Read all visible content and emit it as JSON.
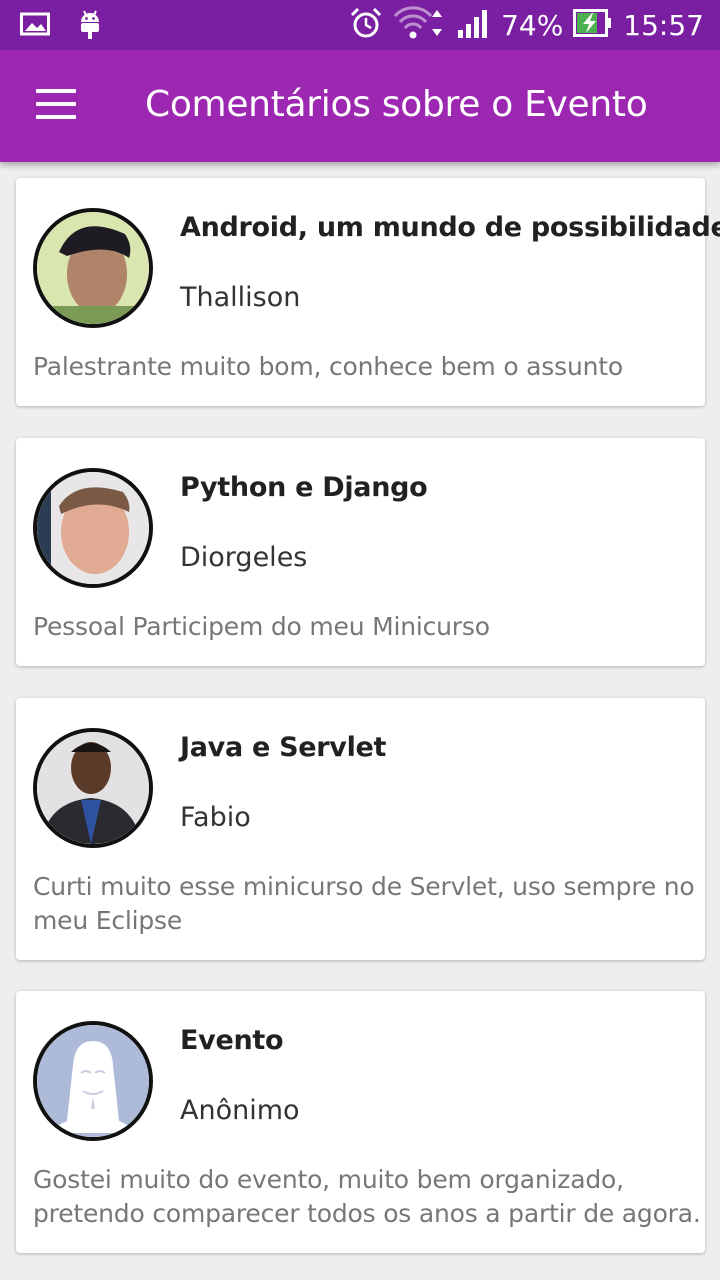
{
  "status_bar": {
    "battery": "74%",
    "time": "15:57",
    "icons": [
      "image-icon",
      "android-icon",
      "alarm-icon",
      "wifi-icon",
      "signal-icon",
      "battery-charging-icon"
    ]
  },
  "app_bar": {
    "menu_icon": "menu-icon",
    "title": "Comentários sobre o Evento"
  },
  "colors": {
    "status_bar": "#7B1FA2",
    "app_bar": "#9C27B0",
    "background": "#eeeeee"
  },
  "comments": [
    {
      "title": "Android, um mundo de possibilidades",
      "author": "Thallison",
      "text": "Palestrante muito bom, conhece bem o assunto"
    },
    {
      "title": "Python e Django",
      "author": "Diorgeles",
      "text": "Pessoal Participem do meu Minicurso"
    },
    {
      "title": "Java e Servlet",
      "author": "Fabio",
      "text": "Curti muito esse minicurso de Servlet, uso sempre no meu Eclipse"
    },
    {
      "title": "Evento",
      "author": "Anônimo",
      "text": "Gostei muito do evento, muito bem organizado, pretendo comparecer todos os anos a partir de agora."
    }
  ]
}
